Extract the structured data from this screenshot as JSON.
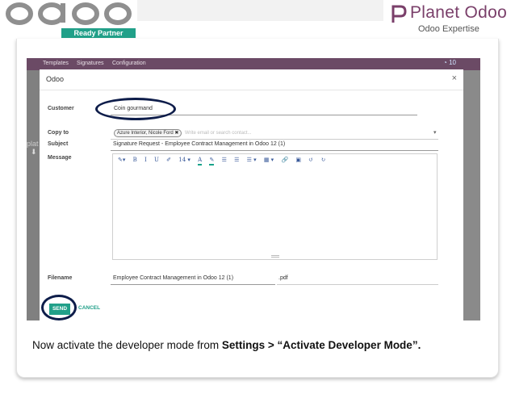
{
  "brand": {
    "left_logo": "odoo",
    "left_badge": "Ready Partner",
    "right_title": "Planet Odoo",
    "right_sub": "Odoo Expertise"
  },
  "app": {
    "menu": [
      "Templates",
      "Signatures",
      "Configuration"
    ],
    "side_text": "plat",
    "notification_count": "10"
  },
  "modal": {
    "title": "Odoo",
    "close": "×",
    "customer_label": "Customer",
    "customer_value": "Coin gourmand",
    "copy_to_label": "Copy to",
    "copy_to_tag": "Azure Interior, Nicole Ford ✖",
    "copy_to_placeholder": "Write email or search contact...",
    "subject_label": "Subject",
    "subject_value": "Signature Request - Employee Contract Management in Odoo 12 (1)",
    "message_label": "Message",
    "toolbar": [
      "✎▾",
      "B",
      "I",
      "U",
      "✐",
      "14 ▾",
      "A",
      "✎",
      "☰",
      "☰",
      "☰ ▾",
      "▦ ▾",
      "🔗",
      "▣",
      "↺",
      "↻"
    ],
    "filename_label": "Filename",
    "filename_value": "Employee Contract Management in Odoo 12 (1)",
    "filename_ext": ".pdf",
    "send_label": "SEND",
    "cancel_label": "CANCEL"
  },
  "caption": {
    "prefix": "Now activate the developer mode from ",
    "bold": "Settings > “Activate Developer Mode”."
  },
  "colors": {
    "accent": "#21a089",
    "topbar": "#6b4a65",
    "circle": "#0e1d4a",
    "brand_purple": "#7a3f6a"
  }
}
